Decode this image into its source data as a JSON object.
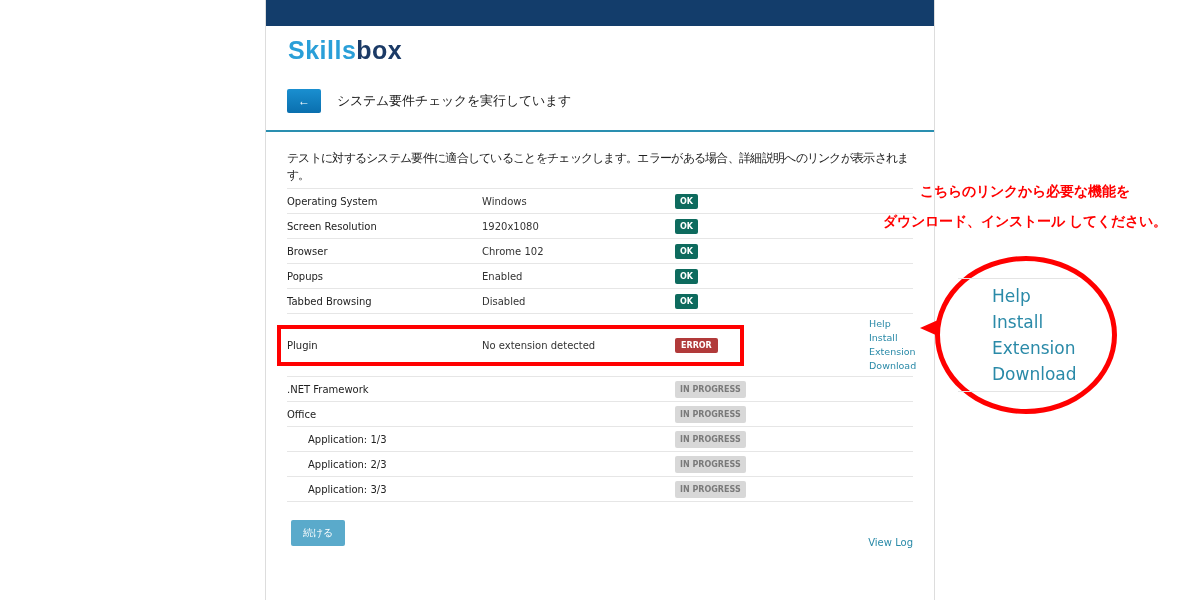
{
  "logo": [
    "Skills",
    "box"
  ],
  "back_button": "←",
  "title": "システム要件チェックを実行しています",
  "intro": "テストに対するシステム要件に適合していることをチェックします。エラーがある場合、詳細説明へのリンクが表示されます。",
  "checks": [
    {
      "label": "Operating System",
      "value": "Windows",
      "status": {
        "kind": "ok",
        "text": "OK"
      },
      "highlighted": false
    },
    {
      "label": "Screen Resolution",
      "value": "1920x1080",
      "status": {
        "kind": "ok",
        "text": "OK"
      },
      "highlighted": false
    },
    {
      "label": "Browser",
      "value": "Chrome 102",
      "status": {
        "kind": "ok",
        "text": "OK"
      },
      "highlighted": false
    },
    {
      "label": "Popups",
      "value": "Enabled",
      "status": {
        "kind": "ok",
        "text": "OK"
      },
      "highlighted": false
    },
    {
      "label": "Tabbed Browsing",
      "value": "Disabled",
      "status": {
        "kind": "ok",
        "text": "OK"
      },
      "highlighted": false
    },
    {
      "label": "Plugin",
      "value": "No extension detected",
      "status": {
        "kind": "error",
        "text": "ERROR"
      },
      "highlighted": true,
      "links": [
        "Help",
        "Install",
        "Extension",
        "Download"
      ]
    },
    {
      "label": ".NET Framework",
      "status": {
        "kind": "progress",
        "text": "IN PROGRESS"
      },
      "highlighted": false
    },
    {
      "label": "Office",
      "status": {
        "kind": "progress",
        "text": "IN PROGRESS"
      },
      "highlighted": false,
      "children": [
        {
          "label": "Application: 1/3",
          "status": {
            "kind": "progress",
            "text": "IN PROGRESS"
          }
        },
        {
          "label": "Application: 2/3",
          "status": {
            "kind": "progress",
            "text": "IN PROGRESS"
          }
        },
        {
          "label": "Application: 3/3",
          "status": {
            "kind": "progress",
            "text": "IN PROGRESS"
          }
        }
      ]
    }
  ],
  "continue_button": "続ける",
  "view_log": "View Log",
  "annotation": {
    "lines": [
      "こちらのリンクから必要な機能を",
      "ダウンロード、インストール してください。"
    ],
    "zoom_links": [
      "Help",
      "Install",
      "Extension",
      "Download"
    ]
  }
}
